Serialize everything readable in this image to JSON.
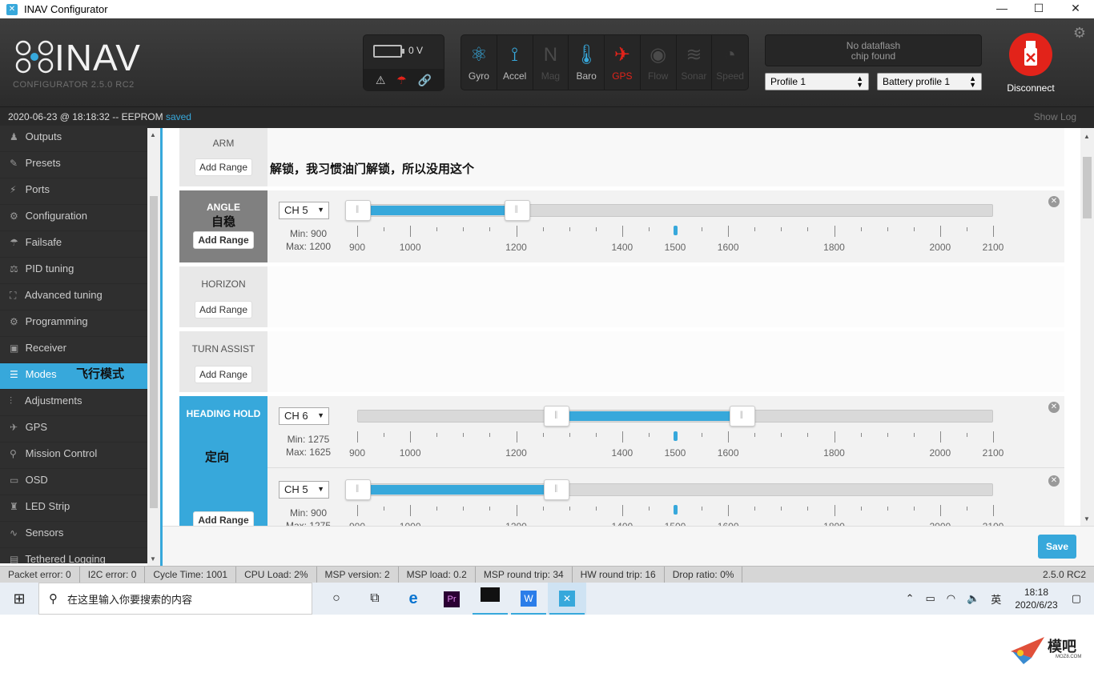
{
  "window": {
    "title": "INAV Configurator",
    "controls": [
      "—",
      "☐",
      "✕"
    ]
  },
  "header": {
    "logo_word": "INAV",
    "logo_sub": "CONFIGURATOR   2.5.0 RC2",
    "voltage": "0 V",
    "sensors": [
      {
        "label": "Gyro",
        "state": "on",
        "icon": "gyro-icon"
      },
      {
        "label": "Accel",
        "state": "on",
        "icon": "accel-icon"
      },
      {
        "label": "Mag",
        "state": "off",
        "icon": "mag-icon"
      },
      {
        "label": "Baro",
        "state": "on",
        "icon": "baro-icon"
      },
      {
        "label": "GPS",
        "state": "err",
        "icon": "gps-icon"
      },
      {
        "label": "Flow",
        "state": "off",
        "icon": "flow-icon"
      },
      {
        "label": "Sonar",
        "state": "off",
        "icon": "sonar-icon"
      },
      {
        "label": "Speed",
        "state": "off",
        "icon": "speed-icon"
      }
    ],
    "dataflash_line1": "No dataflash",
    "dataflash_line2": "chip found",
    "profile": "Profile 1",
    "battery_profile": "Battery profile 1",
    "disconnect": "Disconnect"
  },
  "status_line": {
    "text": "2020-06-23 @ 18:18:32 -- EEPROM ",
    "saved": "saved",
    "show_log": "Show Log"
  },
  "sidebar": {
    "items": [
      {
        "label": "Outputs",
        "icon": "outputs-icon",
        "glyph": "♟"
      },
      {
        "label": "Presets",
        "icon": "presets-icon",
        "glyph": "✎"
      },
      {
        "label": "Ports",
        "icon": "ports-icon",
        "glyph": "⚡"
      },
      {
        "label": "Configuration",
        "icon": "gear-icon",
        "glyph": "⚙"
      },
      {
        "label": "Failsafe",
        "icon": "parachute-icon",
        "glyph": "☂"
      },
      {
        "label": "PID tuning",
        "icon": "pid-icon",
        "glyph": "⚖"
      },
      {
        "label": "Advanced tuning",
        "icon": "advanced-icon",
        "glyph": "⛶"
      },
      {
        "label": "Programming",
        "icon": "gear-icon",
        "glyph": "⚙"
      },
      {
        "label": "Receiver",
        "icon": "receiver-icon",
        "glyph": "▣"
      },
      {
        "label": "Modes",
        "icon": "modes-icon",
        "glyph": "☰",
        "active": true,
        "note": "飞行模式"
      },
      {
        "label": "Adjustments",
        "icon": "adjustments-icon",
        "glyph": "⫶"
      },
      {
        "label": "GPS",
        "icon": "gps-icon",
        "glyph": "✈"
      },
      {
        "label": "Mission Control",
        "icon": "pin-icon",
        "glyph": "⚲"
      },
      {
        "label": "OSD",
        "icon": "osd-icon",
        "glyph": "▭"
      },
      {
        "label": "LED Strip",
        "icon": "led-icon",
        "glyph": "♜"
      },
      {
        "label": "Sensors",
        "icon": "sensors-icon",
        "glyph": "∿"
      },
      {
        "label": "Tethered Logging",
        "icon": "logging-icon",
        "glyph": "▤"
      }
    ]
  },
  "modes": {
    "arm": {
      "name": "ARM",
      "add": "Add Range",
      "note": "解锁，我习惯油门解锁，所以没用这个"
    },
    "angle": {
      "name": "ANGLE",
      "note": "自稳",
      "add": "Add Range",
      "channel": "CH 5",
      "min": "Min: 900",
      "max": "Max: 1200",
      "min_val": 900,
      "max_val": 1200
    },
    "horizon": {
      "name": "HORIZON",
      "add": "Add Range"
    },
    "turn_assist": {
      "name": "TURN ASSIST",
      "add": "Add Range"
    },
    "heading_hold": {
      "name": "HEADING HOLD",
      "note": "定向",
      "add": "Add Range",
      "ranges": [
        {
          "channel": "CH 6",
          "min": "Min: 1275",
          "max": "Max: 1625",
          "min_val": 1275,
          "max_val": 1625
        },
        {
          "channel": "CH 5",
          "min": "Min: 900",
          "max": "Max: 1275",
          "min_val": 900,
          "max_val": 1275
        }
      ]
    },
    "scale": {
      "min": 900,
      "max": 2100,
      "labels": [
        "900",
        "1000",
        "1200",
        "1400",
        "1500",
        "1600",
        "1800",
        "2000",
        "2100"
      ],
      "marker": 1500
    }
  },
  "save": "Save",
  "statusbar": {
    "cells": [
      "Packet error: 0",
      "I2C error: 0",
      "Cycle Time: 1001",
      "CPU Load: 2%",
      "MSP version: 2",
      "MSP load: 0.2",
      "MSP round trip: 34",
      "HW round trip: 16",
      "Drop ratio: 0%"
    ],
    "version": "2.5.0 RC2"
  },
  "taskbar": {
    "search_placeholder": "在这里输入你要搜索的内容",
    "ime": "英",
    "time": "18:18",
    "date": "2020/6/23"
  },
  "watermark": {
    "text": "模吧",
    "small": "MOZ8.COM"
  },
  "colors": {
    "accent": "#37a8db",
    "error": "#e2231a",
    "dark": "#2f2f2f"
  }
}
